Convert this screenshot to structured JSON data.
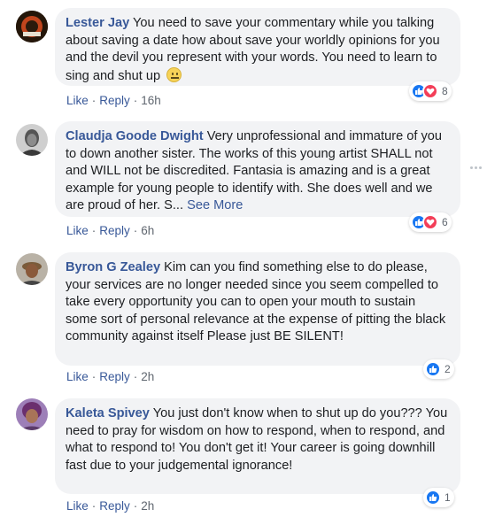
{
  "comments": [
    {
      "author": "Lester Jay",
      "text": "You need to save your commentary while you talking about saving a date how about save your worldly opinions for you and the devil you represent with your words. You need to learn to sing and shut up",
      "reaction_count": "8",
      "like": "Like",
      "reply": "Reply",
      "time": "16h"
    },
    {
      "author": "Claudja Goode Dwight",
      "text": "Very unprofessional and immature of you to down another sister. The works of this young artist SHALL not and WILL not be discredited. Fantasia is amazing and is a great example for young people to identify with. She does well and we are proud of her. S...",
      "see_more": "See More",
      "reaction_count": "6",
      "like": "Like",
      "reply": "Reply",
      "time": "6h"
    },
    {
      "author": "Byron G Zealey",
      "text": "Kim can you find something else to do please, your services are no longer needed since you seem compelled to take every opportunity you can to open your mouth to sustain some sort of personal relevance at the expense of pitting the black community against itself Please just BE SILENT!",
      "reaction_count": "2",
      "like": "Like",
      "reply": "Reply",
      "time": "2h"
    },
    {
      "author": "Kaleta Spivey",
      "text": "You just don't know when to shut up do you??? You need to pray for wisdom on how to respond, when to respond, and what to respond to! You don't get it! Your career is going downhill fast due to your judgemental ignorance!",
      "reaction_count": "1",
      "like": "Like",
      "reply": "Reply",
      "time": "2h"
    }
  ],
  "separator": "·",
  "icons": {
    "emoji": "grimace-emoji-icon",
    "like": "thumbs-up-icon",
    "love": "heart-icon",
    "more": "more-dots-icon"
  },
  "colors": {
    "author": "#385898",
    "bubble": "#f2f3f5",
    "like": "#1877f2",
    "love": "#f33e58"
  }
}
